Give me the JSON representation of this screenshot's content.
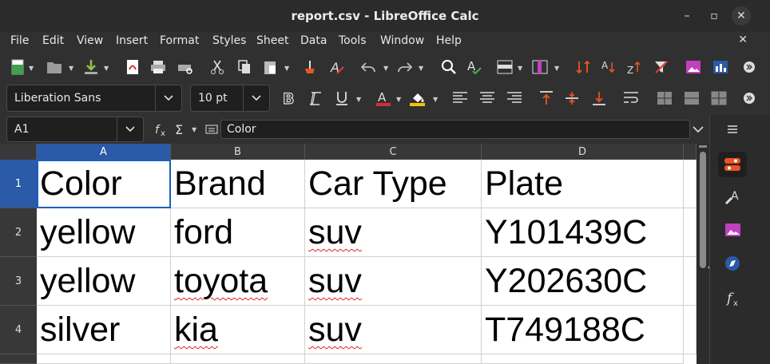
{
  "window": {
    "title": "report.csv - LibreOffice Calc"
  },
  "menu": {
    "items": [
      "File",
      "Edit",
      "View",
      "Insert",
      "Format",
      "Styles",
      "Sheet",
      "Data",
      "Tools",
      "Window",
      "Help"
    ]
  },
  "format_bar": {
    "font_name": "Liberation Sans",
    "font_size": "10 pt"
  },
  "formula_bar": {
    "cell_ref": "A1",
    "content": "Color"
  },
  "sheet": {
    "columns": [
      "A",
      "B",
      "C",
      "D"
    ],
    "rows": [
      "1",
      "2",
      "3",
      "4"
    ],
    "cells": [
      [
        "Color",
        "Brand",
        "Car Type",
        "Plate"
      ],
      [
        "yellow",
        "ford",
        "suv",
        "Y101439C"
      ],
      [
        "yellow",
        "toyota",
        "suv",
        "Y202630C"
      ],
      [
        "silver",
        "kia",
        "suv",
        "T749188C"
      ]
    ]
  },
  "colors": {
    "selection": "#2a5aa8",
    "chrome": "#303030",
    "accent_orange": "#e95420"
  }
}
